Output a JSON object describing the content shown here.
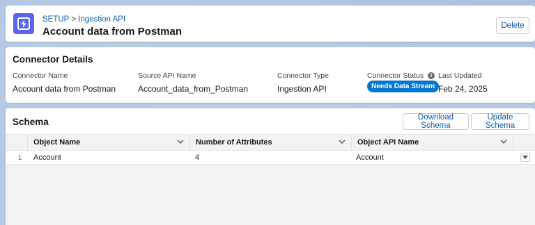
{
  "header": {
    "breadcrumb_root": "SETUP",
    "breadcrumb_sep": ">",
    "breadcrumb_current": "Ingestion API",
    "title": "Account data from Postman",
    "delete_label": "Delete",
    "icon": "ingestion-api-icon"
  },
  "details": {
    "title": "Connector Details",
    "fields": [
      {
        "label": "Connector Name",
        "value": "Account data from Postman"
      },
      {
        "label": "Source API Name",
        "value": "Account_data_from_Postman"
      },
      {
        "label": "Connector Type",
        "value": "Ingestion API"
      },
      {
        "label": "Connector Status",
        "value": "Needs Data Stream"
      },
      {
        "label": "Last Updated",
        "value": "Feb 24, 2025"
      }
    ],
    "status_color": "#0176d3"
  },
  "schema": {
    "title": "Schema",
    "download_label": "Download Schema",
    "update_label": "Update Schema",
    "columns": [
      "Object Name",
      "Number of Attributes",
      "Object API Name"
    ],
    "rows": [
      {
        "num": "1",
        "object_name": "Account",
        "attributes": "4",
        "api_name": "Account"
      }
    ]
  },
  "colors": {
    "accent": "#0b5cab",
    "brand_icon": "#5867e8"
  }
}
